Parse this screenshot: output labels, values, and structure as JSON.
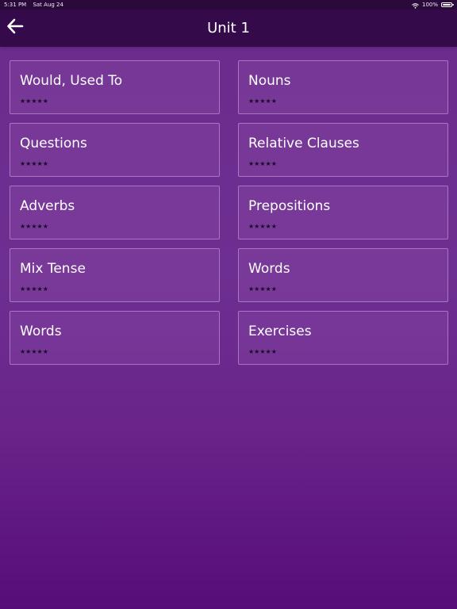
{
  "status_bar": {
    "time": "5:31 PM",
    "date": "Sat Aug 24",
    "battery": "100%",
    "icons": [
      "wifi-icon",
      "battery-icon"
    ]
  },
  "nav": {
    "back_icon": "arrow-left-icon",
    "title": "Unit 1"
  },
  "colors": {
    "nav_background": "#340a4b",
    "page_top": "#6b2b8d",
    "page_bottom": "#570d78",
    "card_border": "#c9a3dd"
  },
  "cards": [
    {
      "title": "Would, Used To",
      "rating": "★★★★★"
    },
    {
      "title": "Nouns",
      "rating": "★★★★★"
    },
    {
      "title": "Questions",
      "rating": "★★★★★"
    },
    {
      "title": "Relative Clauses",
      "rating": "★★★★★"
    },
    {
      "title": "Adverbs",
      "rating": "★★★★★"
    },
    {
      "title": "Prepositions",
      "rating": "★★★★★"
    },
    {
      "title": "Mix Tense",
      "rating": "★★★★★"
    },
    {
      "title": "Words",
      "rating": "★★★★★"
    },
    {
      "title": "Words",
      "rating": "★★★★★"
    },
    {
      "title": "Exercises",
      "rating": "★★★★★"
    }
  ]
}
